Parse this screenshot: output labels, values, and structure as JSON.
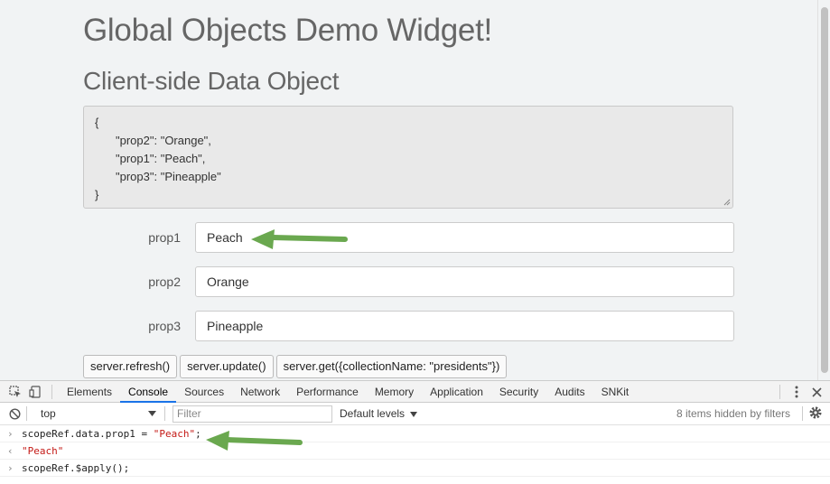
{
  "page": {
    "title": "Global Objects Demo Widget!",
    "subtitle": "Client-side Data Object",
    "json_lines": [
      "{",
      "\"prop2\": \"Orange\",",
      "\"prop1\": \"Peach\",",
      "\"prop3\": \"Pineapple\"",
      "}"
    ],
    "fields": [
      {
        "label": "prop1",
        "value": "Peach"
      },
      {
        "label": "prop2",
        "value": "Orange"
      },
      {
        "label": "prop3",
        "value": "Pineapple"
      }
    ],
    "buttons": [
      "server.refresh()",
      "server.update()",
      "server.get({collectionName: \"presidents\"})"
    ]
  },
  "devtools": {
    "tabs": [
      "Elements",
      "Console",
      "Sources",
      "Network",
      "Performance",
      "Memory",
      "Application",
      "Security",
      "Audits",
      "SNKit"
    ],
    "active_tab": "Console",
    "context": "top",
    "filter_placeholder": "Filter",
    "levels": "Default levels",
    "hidden_note": "8 items hidden by filters",
    "console": [
      {
        "type": "input",
        "prefix": "scopeRef.data.prop1 = ",
        "string": "\"Peach\"",
        "suffix": ";"
      },
      {
        "type": "output",
        "text": "\"Peach\""
      },
      {
        "type": "input",
        "prefix": "scopeRef.$apply();",
        "string": "",
        "suffix": ""
      }
    ]
  },
  "colors": {
    "accent": "#1a73e8",
    "arrow": "#6aa84f",
    "console_string": "#c41a16"
  }
}
